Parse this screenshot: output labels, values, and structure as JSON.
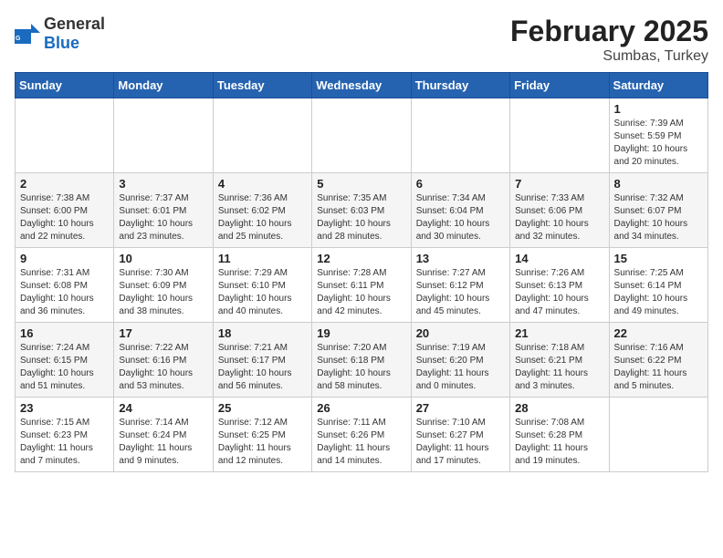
{
  "header": {
    "logo_general": "General",
    "logo_blue": "Blue",
    "title": "February 2025",
    "subtitle": "Sumbas, Turkey"
  },
  "days_of_week": [
    "Sunday",
    "Monday",
    "Tuesday",
    "Wednesday",
    "Thursday",
    "Friday",
    "Saturday"
  ],
  "weeks": [
    [
      {
        "day": "",
        "info": ""
      },
      {
        "day": "",
        "info": ""
      },
      {
        "day": "",
        "info": ""
      },
      {
        "day": "",
        "info": ""
      },
      {
        "day": "",
        "info": ""
      },
      {
        "day": "",
        "info": ""
      },
      {
        "day": "1",
        "info": "Sunrise: 7:39 AM\nSunset: 5:59 PM\nDaylight: 10 hours and 20 minutes."
      }
    ],
    [
      {
        "day": "2",
        "info": "Sunrise: 7:38 AM\nSunset: 6:00 PM\nDaylight: 10 hours and 22 minutes."
      },
      {
        "day": "3",
        "info": "Sunrise: 7:37 AM\nSunset: 6:01 PM\nDaylight: 10 hours and 23 minutes."
      },
      {
        "day": "4",
        "info": "Sunrise: 7:36 AM\nSunset: 6:02 PM\nDaylight: 10 hours and 25 minutes."
      },
      {
        "day": "5",
        "info": "Sunrise: 7:35 AM\nSunset: 6:03 PM\nDaylight: 10 hours and 28 minutes."
      },
      {
        "day": "6",
        "info": "Sunrise: 7:34 AM\nSunset: 6:04 PM\nDaylight: 10 hours and 30 minutes."
      },
      {
        "day": "7",
        "info": "Sunrise: 7:33 AM\nSunset: 6:06 PM\nDaylight: 10 hours and 32 minutes."
      },
      {
        "day": "8",
        "info": "Sunrise: 7:32 AM\nSunset: 6:07 PM\nDaylight: 10 hours and 34 minutes."
      }
    ],
    [
      {
        "day": "9",
        "info": "Sunrise: 7:31 AM\nSunset: 6:08 PM\nDaylight: 10 hours and 36 minutes."
      },
      {
        "day": "10",
        "info": "Sunrise: 7:30 AM\nSunset: 6:09 PM\nDaylight: 10 hours and 38 minutes."
      },
      {
        "day": "11",
        "info": "Sunrise: 7:29 AM\nSunset: 6:10 PM\nDaylight: 10 hours and 40 minutes."
      },
      {
        "day": "12",
        "info": "Sunrise: 7:28 AM\nSunset: 6:11 PM\nDaylight: 10 hours and 42 minutes."
      },
      {
        "day": "13",
        "info": "Sunrise: 7:27 AM\nSunset: 6:12 PM\nDaylight: 10 hours and 45 minutes."
      },
      {
        "day": "14",
        "info": "Sunrise: 7:26 AM\nSunset: 6:13 PM\nDaylight: 10 hours and 47 minutes."
      },
      {
        "day": "15",
        "info": "Sunrise: 7:25 AM\nSunset: 6:14 PM\nDaylight: 10 hours and 49 minutes."
      }
    ],
    [
      {
        "day": "16",
        "info": "Sunrise: 7:24 AM\nSunset: 6:15 PM\nDaylight: 10 hours and 51 minutes."
      },
      {
        "day": "17",
        "info": "Sunrise: 7:22 AM\nSunset: 6:16 PM\nDaylight: 10 hours and 53 minutes."
      },
      {
        "day": "18",
        "info": "Sunrise: 7:21 AM\nSunset: 6:17 PM\nDaylight: 10 hours and 56 minutes."
      },
      {
        "day": "19",
        "info": "Sunrise: 7:20 AM\nSunset: 6:18 PM\nDaylight: 10 hours and 58 minutes."
      },
      {
        "day": "20",
        "info": "Sunrise: 7:19 AM\nSunset: 6:20 PM\nDaylight: 11 hours and 0 minutes."
      },
      {
        "day": "21",
        "info": "Sunrise: 7:18 AM\nSunset: 6:21 PM\nDaylight: 11 hours and 3 minutes."
      },
      {
        "day": "22",
        "info": "Sunrise: 7:16 AM\nSunset: 6:22 PM\nDaylight: 11 hours and 5 minutes."
      }
    ],
    [
      {
        "day": "23",
        "info": "Sunrise: 7:15 AM\nSunset: 6:23 PM\nDaylight: 11 hours and 7 minutes."
      },
      {
        "day": "24",
        "info": "Sunrise: 7:14 AM\nSunset: 6:24 PM\nDaylight: 11 hours and 9 minutes."
      },
      {
        "day": "25",
        "info": "Sunrise: 7:12 AM\nSunset: 6:25 PM\nDaylight: 11 hours and 12 minutes."
      },
      {
        "day": "26",
        "info": "Sunrise: 7:11 AM\nSunset: 6:26 PM\nDaylight: 11 hours and 14 minutes."
      },
      {
        "day": "27",
        "info": "Sunrise: 7:10 AM\nSunset: 6:27 PM\nDaylight: 11 hours and 17 minutes."
      },
      {
        "day": "28",
        "info": "Sunrise: 7:08 AM\nSunset: 6:28 PM\nDaylight: 11 hours and 19 minutes."
      },
      {
        "day": "",
        "info": ""
      }
    ]
  ]
}
